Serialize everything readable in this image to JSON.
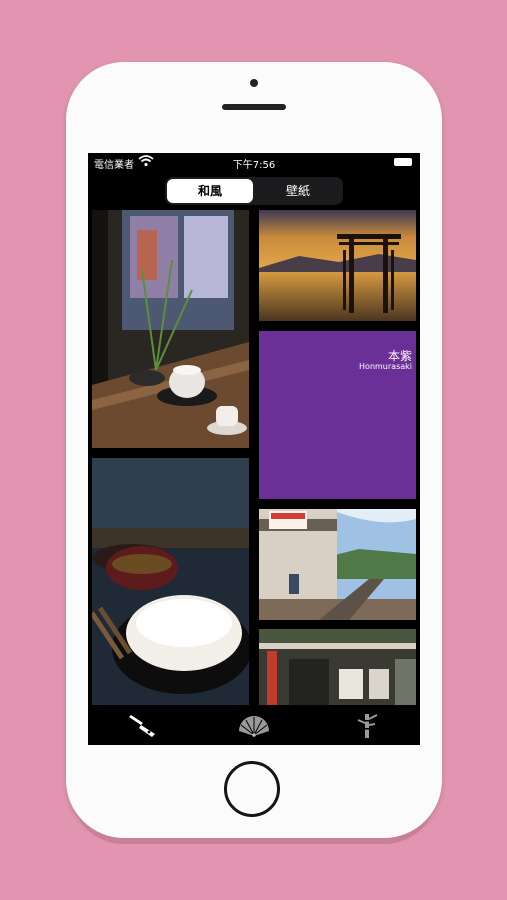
{
  "status_bar": {
    "carrier": "電信業者",
    "time": "下午7:56"
  },
  "segmented_control": {
    "tabs": [
      {
        "label": "和風",
        "selected": true
      },
      {
        "label": "壁紙",
        "selected": false
      }
    ]
  },
  "gallery": {
    "featured_color": {
      "name_kanji": "本紫",
      "name_romaji": "Honmurasaki",
      "hex": "#6b2f98"
    }
  },
  "tab_bar": {
    "icons": [
      "knife-icon",
      "folding-fan-icon",
      "bamboo-icon"
    ]
  },
  "colors": {
    "background": "#e295b0",
    "phone_body": "#fbfbfb",
    "screen": "#000000"
  }
}
